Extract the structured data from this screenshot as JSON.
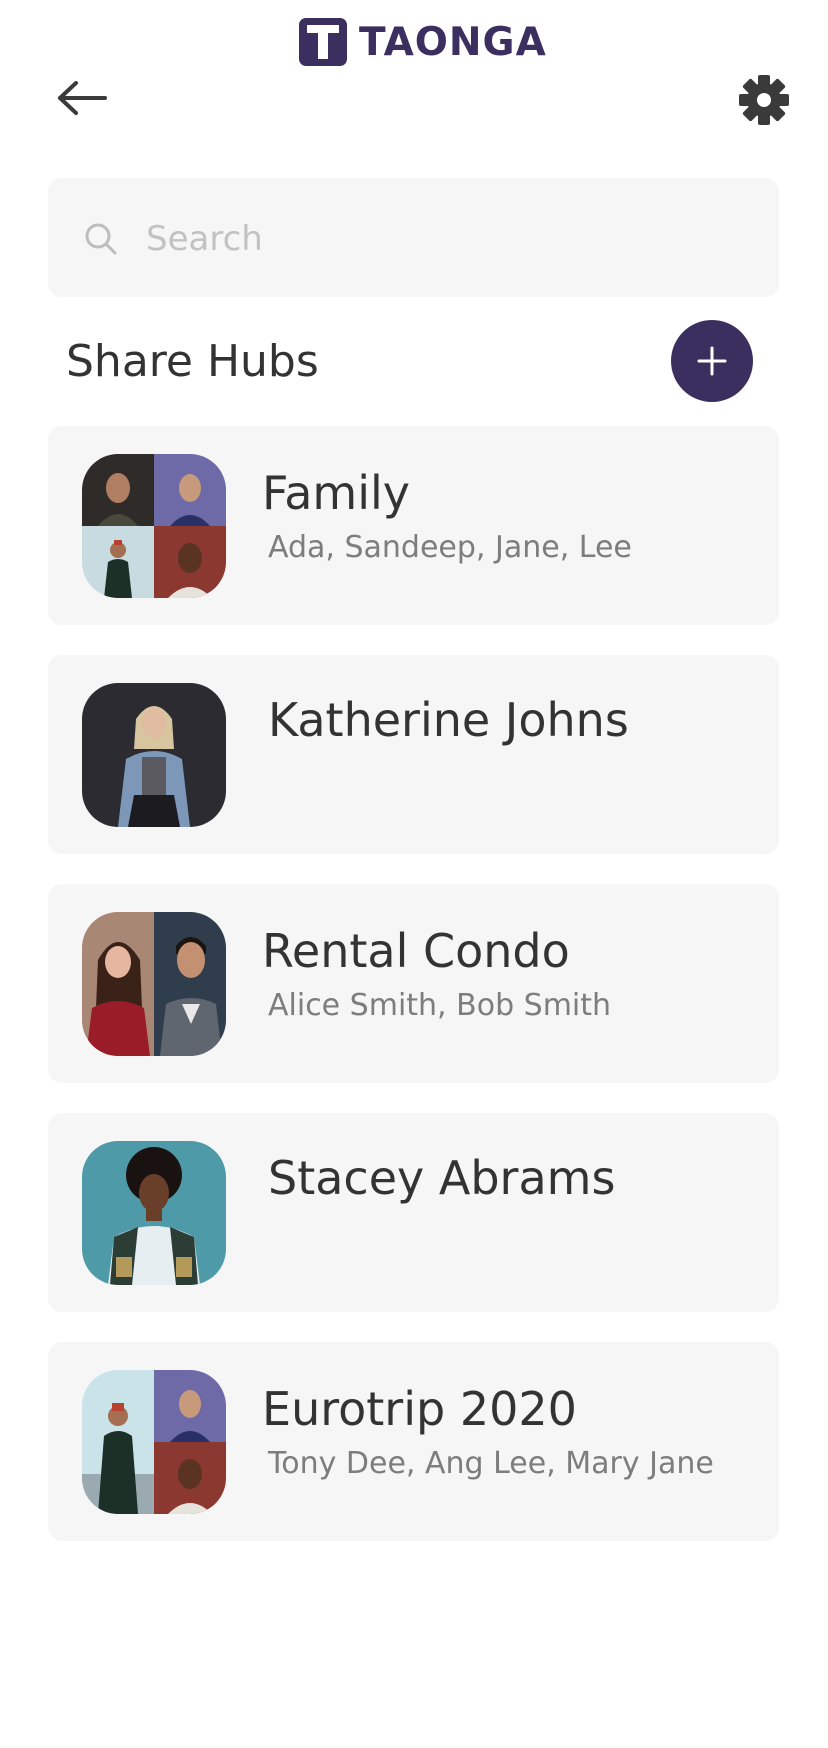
{
  "app": {
    "name": "TAONGA",
    "logo_letter": "T",
    "brand_color": "#3b2f5f"
  },
  "header": {
    "back_icon": "arrow-left-icon",
    "settings_icon": "gear-icon"
  },
  "search": {
    "placeholder": "Search",
    "value": "",
    "icon": "search-icon"
  },
  "section": {
    "title": "Share Hubs",
    "add_icon": "plus-icon"
  },
  "hubs": [
    {
      "title": "Family",
      "members": "Ada, Sandeep, Jane, Lee"
    },
    {
      "title": "Katherine Johns",
      "members": ""
    },
    {
      "title": "Rental Condo",
      "members": "Alice Smith, Bob Smith"
    },
    {
      "title": "Stacey Abrams",
      "members": ""
    },
    {
      "title": "Eurotrip 2020",
      "members": "Tony Dee, Ang Lee, Mary Jane"
    }
  ]
}
